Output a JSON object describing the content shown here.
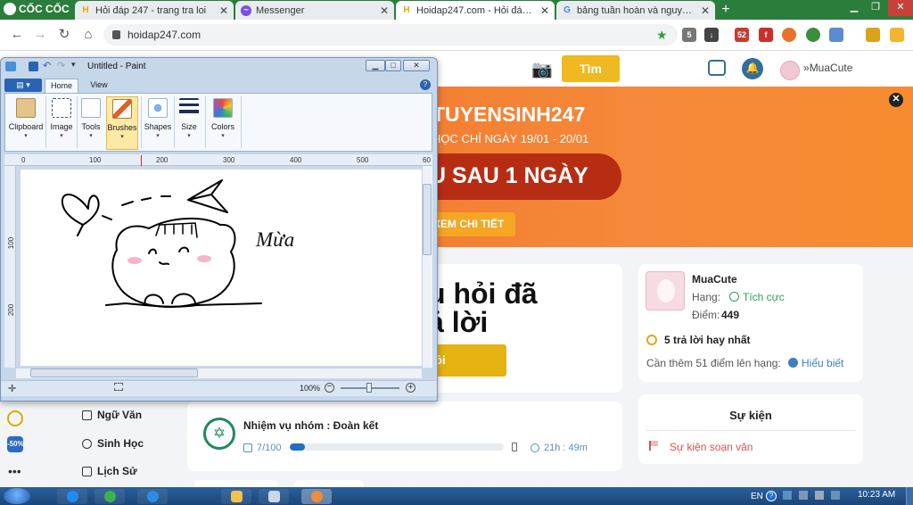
{
  "browser": {
    "brand": "CỐC CỐC",
    "tabs": [
      {
        "title": "Hỏi đáp 247 - trang tra loi",
        "favicon": "hoidap-h-icon",
        "active": false
      },
      {
        "title": "Messenger",
        "favicon": "messenger-icon",
        "active": false
      },
      {
        "title": "Hoidap247.com - Hỏi đáp bà",
        "favicon": "hoidap-h-icon",
        "active": true
      },
      {
        "title": "bảng tuần hoàn và nguyên tố",
        "favicon": "google-g-icon",
        "active": false
      }
    ],
    "new_tab": "+",
    "url": "hoidap247.com",
    "extension_badge": "52",
    "accent": "#2b7d3b"
  },
  "site": {
    "search_button": "Tìm",
    "user": "MuaCute",
    "banner": {
      "title": "TUYENSINH247",
      "dates": "HỌC CHỈ NGÀY 19/01 - 20/01",
      "pill": "U SAU 1 NGÀY",
      "cta": "XEM CHI TIẾT",
      "color": "#f26e22"
    },
    "ask": {
      "line1": "u hỏi đã",
      "line2": "ả lời",
      "button": "ỏi"
    },
    "mission": {
      "title": "Nhiệm vụ nhóm : Đoàn kết",
      "count": "7/100",
      "progress_fraction": 0.07,
      "time": "21h : 49m"
    },
    "profile": {
      "name": "MuaCute",
      "rank_label": "Hạng:",
      "rank": "Tích cực",
      "points_label": "Điểm:",
      "points": "449",
      "best_answers": "5 trả lời hay nhất",
      "need_text": "Cần thêm 51 điểm lên hạng:",
      "know_more": "Hiểu biết"
    },
    "events": {
      "title": "Sự kiện",
      "item": "Sự kiện soạn văn"
    },
    "subjects": [
      "Ngữ Văn",
      "Sinh Học",
      "Lịch Sử"
    ],
    "rail_badge": "-50%"
  },
  "paint": {
    "title": "Untitled - Paint",
    "file_menu": "",
    "tabs": [
      "Home",
      "View"
    ],
    "groups": [
      "Clipboard",
      "Image",
      "Tools",
      "Brushes",
      "Shapes",
      "Size",
      "Colors"
    ],
    "selected_group": "Brushes",
    "ruler_h": [
      "0",
      "100",
      "200",
      "300",
      "400",
      "500",
      "60"
    ],
    "ruler_v": [
      "100",
      "200"
    ],
    "drawing_text": "Mừa",
    "zoom": "100%"
  },
  "taskbar": {
    "lang": "EN",
    "time": "10:23 AM",
    "apps": [
      "zalo",
      "coccoc",
      "ie",
      "explorer",
      "window",
      "paint"
    ]
  }
}
